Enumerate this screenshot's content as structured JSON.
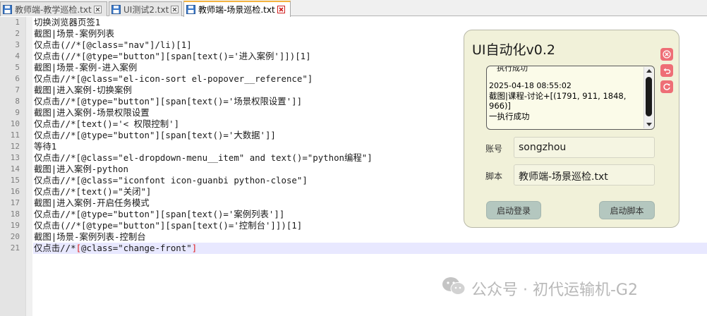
{
  "tabs": [
    {
      "label": "教师端-教学巡检.txt",
      "active": false
    },
    {
      "label": "UI测试2.txt",
      "active": false
    },
    {
      "label": "教师端-场景巡检.txt",
      "active": true
    }
  ],
  "editor": {
    "lines": [
      "切换浏览器页签1",
      "截图|场景-案例列表",
      "仅点击(//*[@class=\"nav\"]/li)[1]",
      "仅点击(//*[@type=\"button\"][span[text()='进入案例']])[1]",
      "截图|场景-案例-进入案例",
      "仅点击//*[@class=\"el-icon-sort el-popover__reference\"]",
      "截图|进入案例-切换案例",
      "仅点击//*[@type=\"button\"][span[text()='场景权限设置']]",
      "截图|进入案例-场景权限设置",
      "仅点击//*[text()='< 权限控制']",
      "仅点击//*[@type=\"button\"][span[text()='大数据']]",
      "等待1",
      "仅点击//*[@class=\"el-dropdown-menu__item\" and text()=\"python编程\"]",
      "截图|进入案例-python",
      "仅点击//*[@class=\"iconfont icon-guanbi python-close\"]",
      "仅点击//*[text()=\"关闭\"]",
      "截图|进入案例-开启任务模式",
      "仅点击//*[@type=\"button\"][span[text()='案例列表']]",
      "仅点击(//*[@type=\"button\"][span[text()='控制台']])[1]",
      "截图|场景-案例列表-控制台",
      "仅点击//*[@class=\"change-front\"]"
    ],
    "line_numbers": [
      "1",
      "2",
      "3",
      "4",
      "5",
      "6",
      "7",
      "8",
      "9",
      "10",
      "11",
      "12",
      "13",
      "14",
      "15",
      "16",
      "17",
      "18",
      "19",
      "20",
      "21"
    ],
    "current_line": 21
  },
  "panel": {
    "title": "UI自动化v0.2",
    "log": {
      "head": "执行成功",
      "timestamp": "2025-04-18 08:55:02",
      "message": "截图|课程-讨论+[(1791, 911, 1848, 966)]",
      "result": "一执行成功"
    },
    "account_label": "账号",
    "account_value": "songzhou",
    "script_label": "脚本",
    "script_value": "教师端-场景巡检.txt",
    "login_button": "启动登录",
    "run_button": "启动脚本",
    "side_icons": [
      "close-icon",
      "undo-icon",
      "refresh-icon"
    ],
    "accent_color": "#ee6e76"
  },
  "watermark": {
    "text": "公众号 · 初代运输机-G2"
  }
}
